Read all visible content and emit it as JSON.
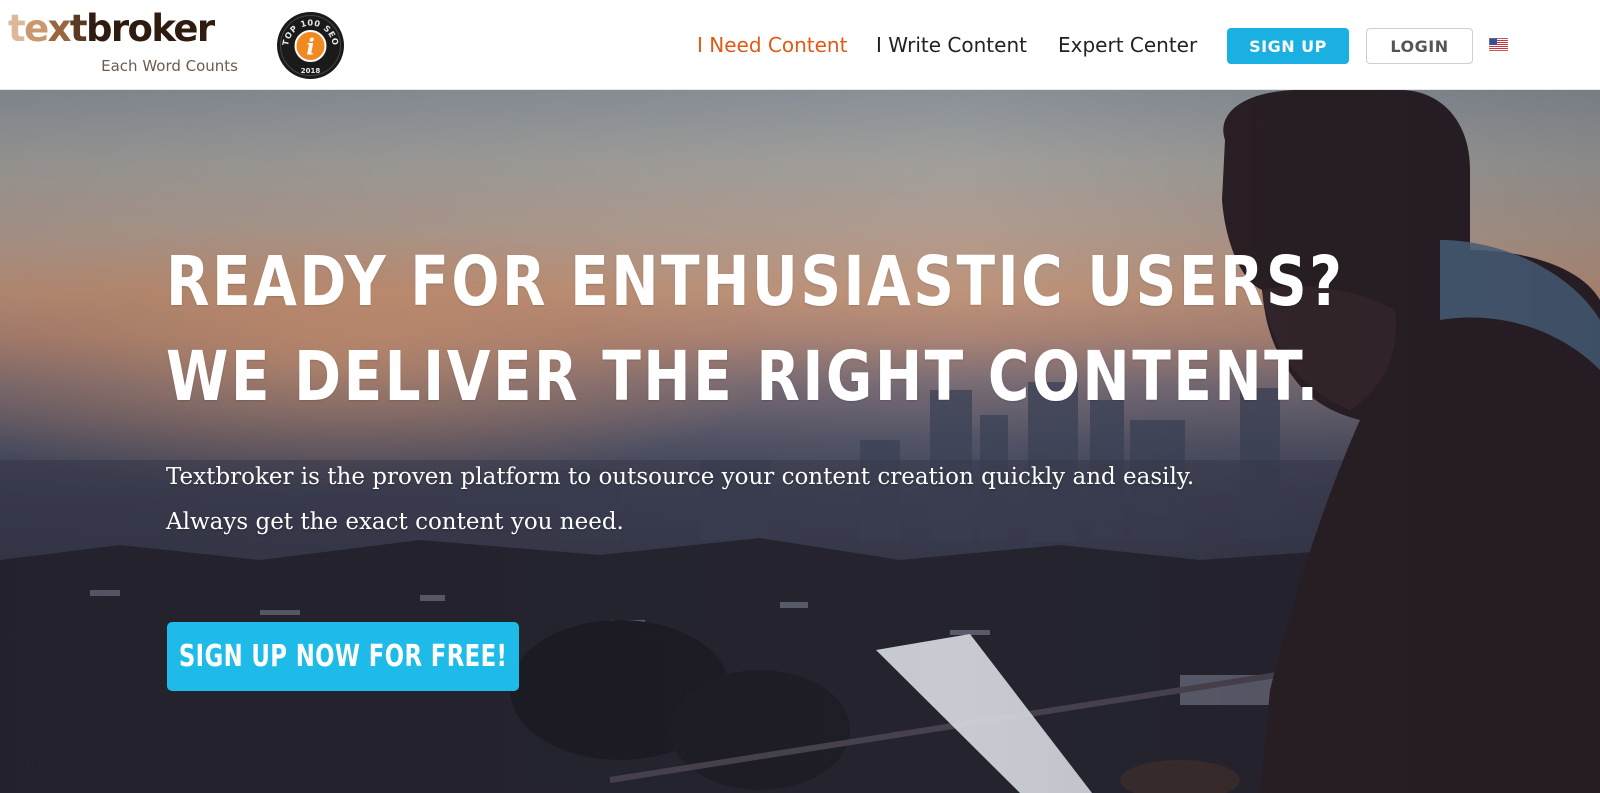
{
  "brand": {
    "logo_parts": [
      "t",
      "e",
      "x",
      "t",
      "broker"
    ],
    "tagline": "Each Word Counts",
    "badge_top": "TOP 100 SEO",
    "badge_year": "2018",
    "badge_letter": "i"
  },
  "nav": {
    "need_content": "I Need Content",
    "write_content": "I Write Content",
    "expert_center": "Expert Center",
    "signup": "SIGN UP",
    "login": "LOGIN",
    "flag_icon": "us-flag-icon"
  },
  "hero": {
    "title_line1": "READY FOR ENTHUSIASTIC USERS?",
    "title_line2": "WE DELIVER THE RIGHT CONTENT.",
    "text_line1": "Textbroker is the proven platform to outsource your content creation quickly and easily.",
    "text_line2": "Always get the exact content you need.",
    "cta": "SIGN UP NOW FOR FREE!"
  },
  "colors": {
    "accent": "#1ab0e1",
    "active_nav": "#e05a14",
    "logo_dark": "#2f1c10",
    "logo_light": "#dcb899"
  }
}
